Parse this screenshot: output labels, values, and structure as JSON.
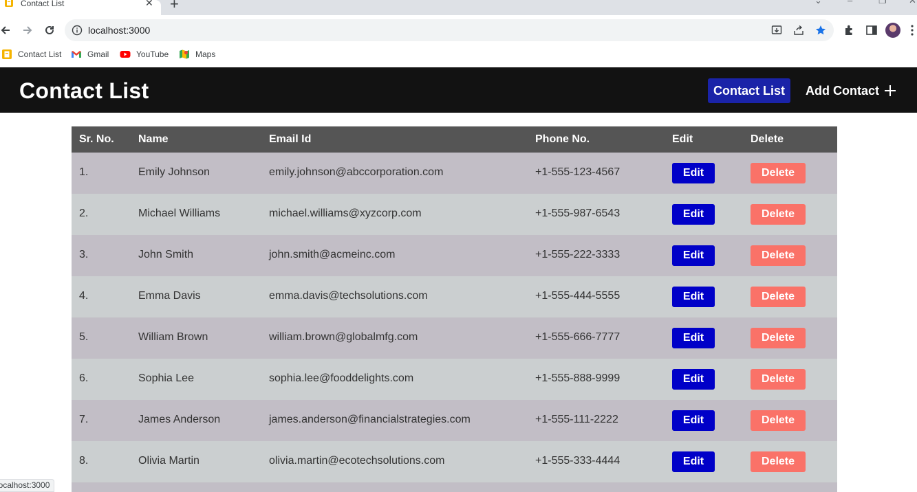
{
  "browser": {
    "tab_title": "Contact List",
    "url": "localhost:3000",
    "bookmarks": [
      {
        "label": "Contact List",
        "icon": "app-favicon-icon"
      },
      {
        "label": "Gmail",
        "icon": "gmail-icon"
      },
      {
        "label": "YouTube",
        "icon": "youtube-icon"
      },
      {
        "label": "Maps",
        "icon": "maps-icon"
      }
    ],
    "status_url": "localhost:3000"
  },
  "app": {
    "title": "Contact List",
    "nav_contact_list": "Contact List",
    "nav_add_contact": "Add Contact"
  },
  "table": {
    "headers": {
      "sr_no": "Sr. No.",
      "name": "Name",
      "email": "Email Id",
      "phone": "Phone No.",
      "edit": "Edit",
      "delete": "Delete"
    },
    "edit_label": "Edit",
    "delete_label": "Delete",
    "rows": [
      {
        "sr": "1.",
        "name": "Emily Johnson",
        "email": "emily.johnson@abccorporation.com",
        "phone": "+1-555-123-4567"
      },
      {
        "sr": "2.",
        "name": "Michael Williams",
        "email": "michael.williams@xyzcorp.com",
        "phone": "+1-555-987-6543"
      },
      {
        "sr": "3.",
        "name": "John Smith",
        "email": "john.smith@acmeinc.com",
        "phone": "+1-555-222-3333"
      },
      {
        "sr": "4.",
        "name": "Emma Davis",
        "email": "emma.davis@techsolutions.com",
        "phone": "+1-555-444-5555"
      },
      {
        "sr": "5.",
        "name": "William Brown",
        "email": "william.brown@globalmfg.com",
        "phone": "+1-555-666-7777"
      },
      {
        "sr": "6.",
        "name": "Sophia Lee",
        "email": "sophia.lee@fooddelights.com",
        "phone": "+1-555-888-9999"
      },
      {
        "sr": "7.",
        "name": "James Anderson",
        "email": "james.anderson@financialstrategies.com",
        "phone": "+1-555-111-2222"
      },
      {
        "sr": "8.",
        "name": "Olivia Martin",
        "email": "olivia.martin@ecotechsolutions.com",
        "phone": "+1-555-333-4444"
      }
    ]
  },
  "colors": {
    "header_bg": "#121212",
    "nav_active_bg": "#1a23a8",
    "table_header_bg": "#555555",
    "row_odd_bg": "#c2bec6",
    "row_even_bg": "#cbcfd0",
    "edit_button": "#0000c8",
    "delete_button": "#fa7268"
  }
}
